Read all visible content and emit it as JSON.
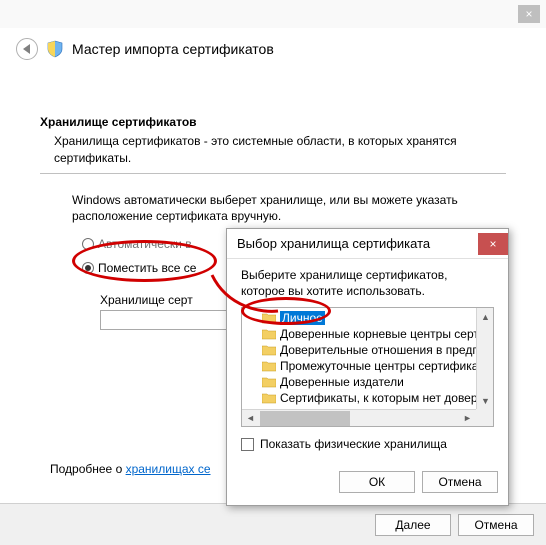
{
  "outer": {
    "close_icon": "×"
  },
  "wizard": {
    "title": "Мастер импорта сертификатов",
    "section_title": "Хранилище сертификатов",
    "section_desc": "Хранилища сертификатов - это системные области, в которых хранятся сертификаты.",
    "body_text": "Windows автоматически выберет хранилище, или вы можете указать расположение сертификата вручную.",
    "radio_auto": "Автоматически в",
    "radio_place": "Поместить все се",
    "store_label": "Хранилище серт",
    "learn_prefix": "Подробнее о ",
    "learn_link": "хранилищах се",
    "next_btn": "Далее",
    "cancel_btn": "Отмена"
  },
  "modal": {
    "title": "Выбор хранилища сертификата",
    "close_icon": "×",
    "desc": "Выберите хранилище сертификатов, которое вы хотите использовать.",
    "tree": [
      "Личное",
      "Доверенные корневые центры сертиф",
      "Доверительные отношения в предпри",
      "Промежуточные центры сертификации",
      "Доверенные издатели",
      "Сертификаты, к которым нет довери"
    ],
    "show_physical": "Показать физические хранилища",
    "ok_btn": "ОК",
    "cancel_btn": "Отмена"
  }
}
